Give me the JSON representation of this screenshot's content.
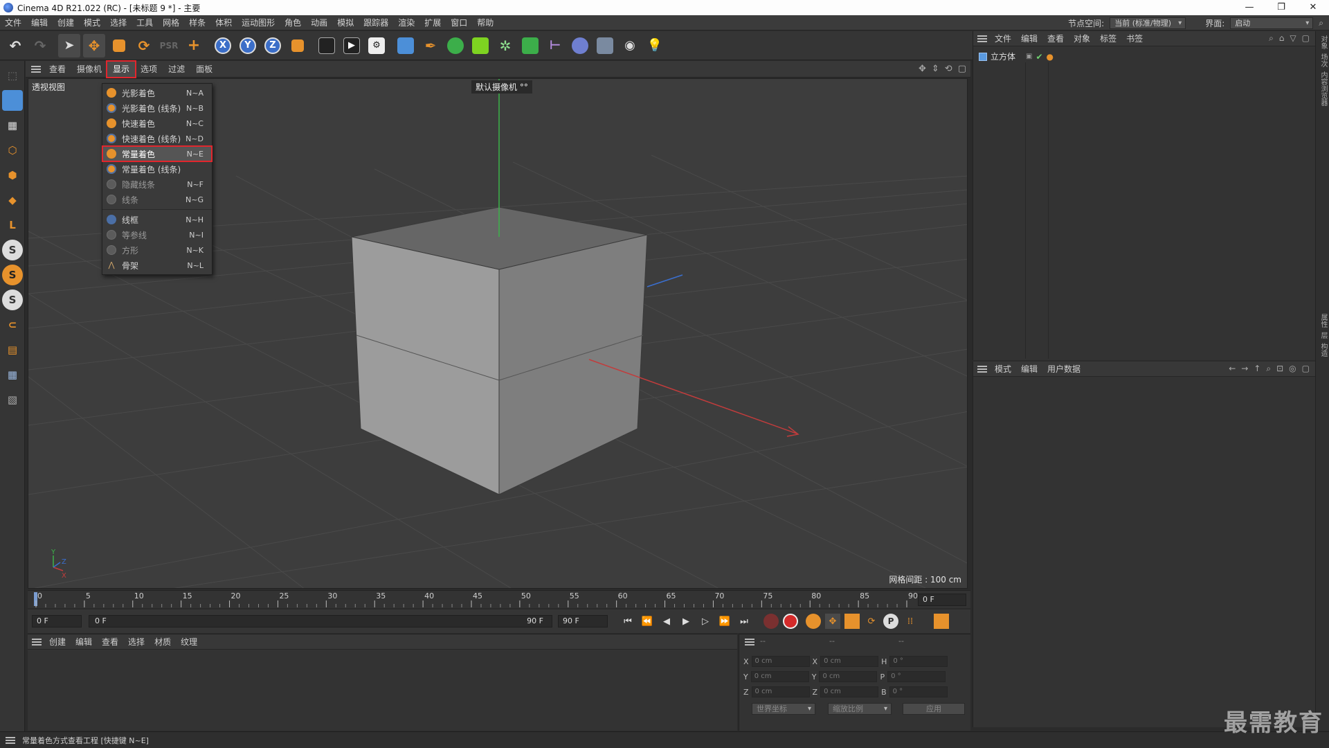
{
  "window": {
    "title": "Cinema 4D R21.022 (RC) - [未标题 9 *] - 主要",
    "controls": [
      "—",
      "❐",
      "✕"
    ]
  },
  "menubar": {
    "items": [
      "文件",
      "编辑",
      "创建",
      "模式",
      "选择",
      "工具",
      "网格",
      "样条",
      "体积",
      "运动图形",
      "角色",
      "动画",
      "模拟",
      "跟踪器",
      "渲染",
      "扩展",
      "窗口",
      "帮助"
    ],
    "node_space_label": "节点空间:",
    "node_space_value": "当前 (标准/物理)",
    "layout_label": "界面:",
    "layout_value": "启动"
  },
  "viewport_menu": {
    "items": [
      "查看",
      "摄像机",
      "显示",
      "选项",
      "过滤",
      "面板"
    ],
    "active": "显示"
  },
  "viewport": {
    "view_name": "透视视图",
    "camera_label": "默认摄像机 °°",
    "grid_spacing": "网格间距 : 100 cm",
    "axis_labels": {
      "y": "Y",
      "z": "Z",
      "x": "X"
    }
  },
  "display_menu": {
    "items": [
      {
        "label": "光影着色",
        "shortcut": "N~A",
        "icon": "orange-sphere-icon"
      },
      {
        "label": "光影着色 (线条)",
        "shortcut": "N~B",
        "icon": "orange-sphere-lines-icon"
      },
      {
        "label": "快速着色",
        "shortcut": "N~C",
        "icon": "orange-sphere-icon"
      },
      {
        "label": "快速着色 (线条)",
        "shortcut": "N~D",
        "icon": "orange-sphere-lines-icon"
      },
      {
        "label": "常量着色",
        "shortcut": "N~E",
        "icon": "orange-sphere-icon",
        "selected": true
      },
      {
        "label": "常量着色 (线条)",
        "shortcut": "",
        "icon": "orange-sphere-lines-icon"
      },
      {
        "label": "隐藏线条",
        "shortcut": "N~F",
        "icon": "grey-sphere-icon",
        "dim": true
      },
      {
        "label": "线条",
        "shortcut": "N~G",
        "icon": "grey-sphere-icon",
        "dim": true
      },
      {
        "label": "线框",
        "shortcut": "N~H",
        "icon": "wireframe-sphere-icon"
      },
      {
        "label": "等参线",
        "shortcut": "N~I",
        "icon": "grey-sphere-icon",
        "dim": true
      },
      {
        "label": "方形",
        "shortcut": "N~K",
        "icon": "grey-sphere-icon",
        "dim": true
      },
      {
        "label": "骨架",
        "shortcut": "N~L",
        "icon": "skeleton-icon"
      }
    ]
  },
  "object_manager": {
    "menu": [
      "文件",
      "编辑",
      "查看",
      "对象",
      "标签",
      "书签"
    ],
    "object_name": "立方体"
  },
  "attribute_manager": {
    "menu": [
      "模式",
      "编辑",
      "用户数据"
    ]
  },
  "side_tabs": [
    "对象",
    "场次",
    "内容浏览器",
    "属性",
    "层",
    "构造"
  ],
  "timeline": {
    "ticks": [
      "0",
      "5",
      "10",
      "15",
      "20",
      "25",
      "30",
      "35",
      "40",
      "45",
      "50",
      "55",
      "60",
      "65",
      "70",
      "75",
      "80",
      "85",
      "90"
    ],
    "current_frame": "0 F"
  },
  "transport": {
    "start_frame": "0 F",
    "range_start": "0 F",
    "range_end": "90 F",
    "end_frame": "90 F"
  },
  "material_manager": {
    "menu": [
      "创建",
      "编辑",
      "查看",
      "选择",
      "材质",
      "纹理"
    ]
  },
  "coordinates": {
    "header": [
      "--",
      "--",
      "--"
    ],
    "rows": [
      {
        "axis": "X",
        "pos": "0 cm",
        "axis2": "X",
        "size": "0 cm",
        "rot_axis": "H",
        "rot": "0 °"
      },
      {
        "axis": "Y",
        "pos": "0 cm",
        "axis2": "Y",
        "size": "0 cm",
        "rot_axis": "P",
        "rot": "0 °"
      },
      {
        "axis": "Z",
        "pos": "0 cm",
        "axis2": "Z",
        "size": "0 cm",
        "rot_axis": "B",
        "rot": "0 °"
      }
    ],
    "coord_system": "世界坐标",
    "scale_mode": "缩放比例",
    "apply": "应用"
  },
  "statusbar": {
    "text": "常量着色方式查看工程 [快捷键 N~E]"
  },
  "watermark": "最需教育",
  "colors": {
    "highlight_red": "#e2262d",
    "orange_icon": "#e7922c",
    "viewport_bg": "#3d3d3d",
    "cube_face_top": "#6e6e6e",
    "cube_face_left": "#9a9a9a",
    "cube_face_right": "#7c7c7c"
  }
}
